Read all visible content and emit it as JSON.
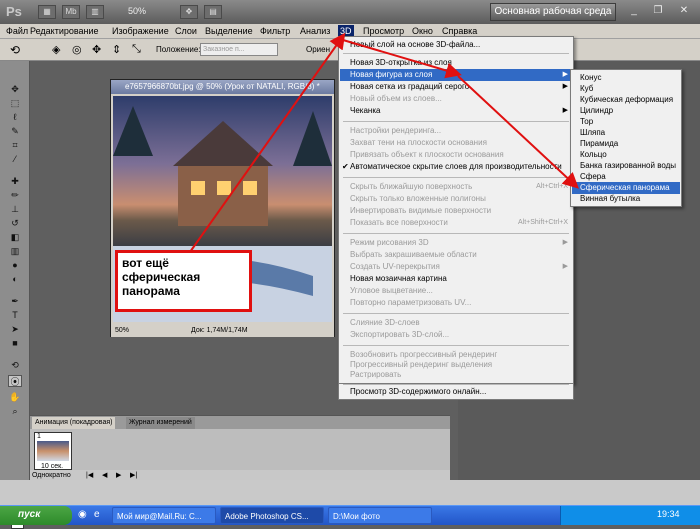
{
  "appbar": {
    "logo": "Ps",
    "btn1": "▦",
    "btn2": "Mb",
    "btn3": "▥",
    "btn4": "✥",
    "btn5": "▤",
    "zoom": "50%",
    "workspace": "Основная рабочая среда"
  },
  "menubar": {
    "items": [
      "Файл",
      "Редактирование",
      "Изображение",
      "Слои",
      "Выделение",
      "Фильтр",
      "Анализ",
      "3D",
      "Просмотр",
      "Окно",
      "Справка"
    ]
  },
  "options": {
    "position_label": "Положение:",
    "position_value": "Заказное п...",
    "orient": "Ориен"
  },
  "document": {
    "title": "e7657966870bt.jpg @ 50% (Урок от NATALI, RGB/8) *",
    "zoom": "50%",
    "doc_info": "Док: 1,74M/1,74M"
  },
  "menu3d": {
    "items": [
      {
        "label": "Новый слой на основе 3D-файла..."
      },
      {
        "label": "Новая 3D-открытка из слоя"
      },
      {
        "label": "Новая фигура из слоя"
      },
      {
        "label": "Новая сетка из градаций серого"
      },
      {
        "label": "Новый объем из слоев..."
      },
      {
        "label": "Чеканка"
      },
      {
        "label": "Настройки рендеринга..."
      },
      {
        "label": "Захват тени на плоскости основания"
      },
      {
        "label": "Привязать объект к плоскости основания"
      },
      {
        "label": "Автоматическое скрытие слоев для производительности"
      },
      {
        "label": "Скрыть ближайшую поверхность",
        "shortcut": "Alt+Ctrl+X"
      },
      {
        "label": "Скрыть только вложенные полигоны"
      },
      {
        "label": "Инвертировать видимые поверхности"
      },
      {
        "label": "Показать все поверхности",
        "shortcut": "Alt+Shift+Ctrl+X"
      },
      {
        "label": "Режим рисования 3D"
      },
      {
        "label": "Выбрать закрашиваемые области"
      },
      {
        "label": "Создать UV-перекрытия"
      },
      {
        "label": "Новая мозаичная картина"
      },
      {
        "label": "Угловое выцветание..."
      },
      {
        "label": "Повторно параметризовать UV..."
      },
      {
        "label": "Слияние 3D-слоев"
      },
      {
        "label": "Экспортировать 3D-слой..."
      },
      {
        "label": "Возобновить прогрессивный рендеринг"
      },
      {
        "label": "Прогрессивный рендеринг выделения"
      },
      {
        "label": "Растрировать"
      },
      {
        "label": "Просмотр 3D-содержимого онлайн..."
      }
    ]
  },
  "submenu": {
    "items": [
      "Конус",
      "Куб",
      "Кубическая деформация",
      "Цилиндр",
      "Тор",
      "Шляпа",
      "Пирамида",
      "Кольцо",
      "Банка газированной воды",
      "Сфера",
      "Сферическая панорама",
      "Винная бутылка"
    ]
  },
  "callout": {
    "text": "вот ещё сферическая панорама"
  },
  "anim": {
    "tab1": "Анимация (покадровая)",
    "tab2": "Журнал измерений",
    "frame_num": "1",
    "frame_time": "10 сек.",
    "loop": "Однократно"
  },
  "taskbar": {
    "start": "пуск",
    "tasks": [
      "Мой мир@Mail.Ru: С...",
      "Adobe Photoshop CS...",
      "D:\\Мои фото"
    ],
    "clock": "19:34"
  },
  "colors": {
    "accent": "#316ac5",
    "callout_border": "#e01010",
    "foreground": "#e00000"
  }
}
